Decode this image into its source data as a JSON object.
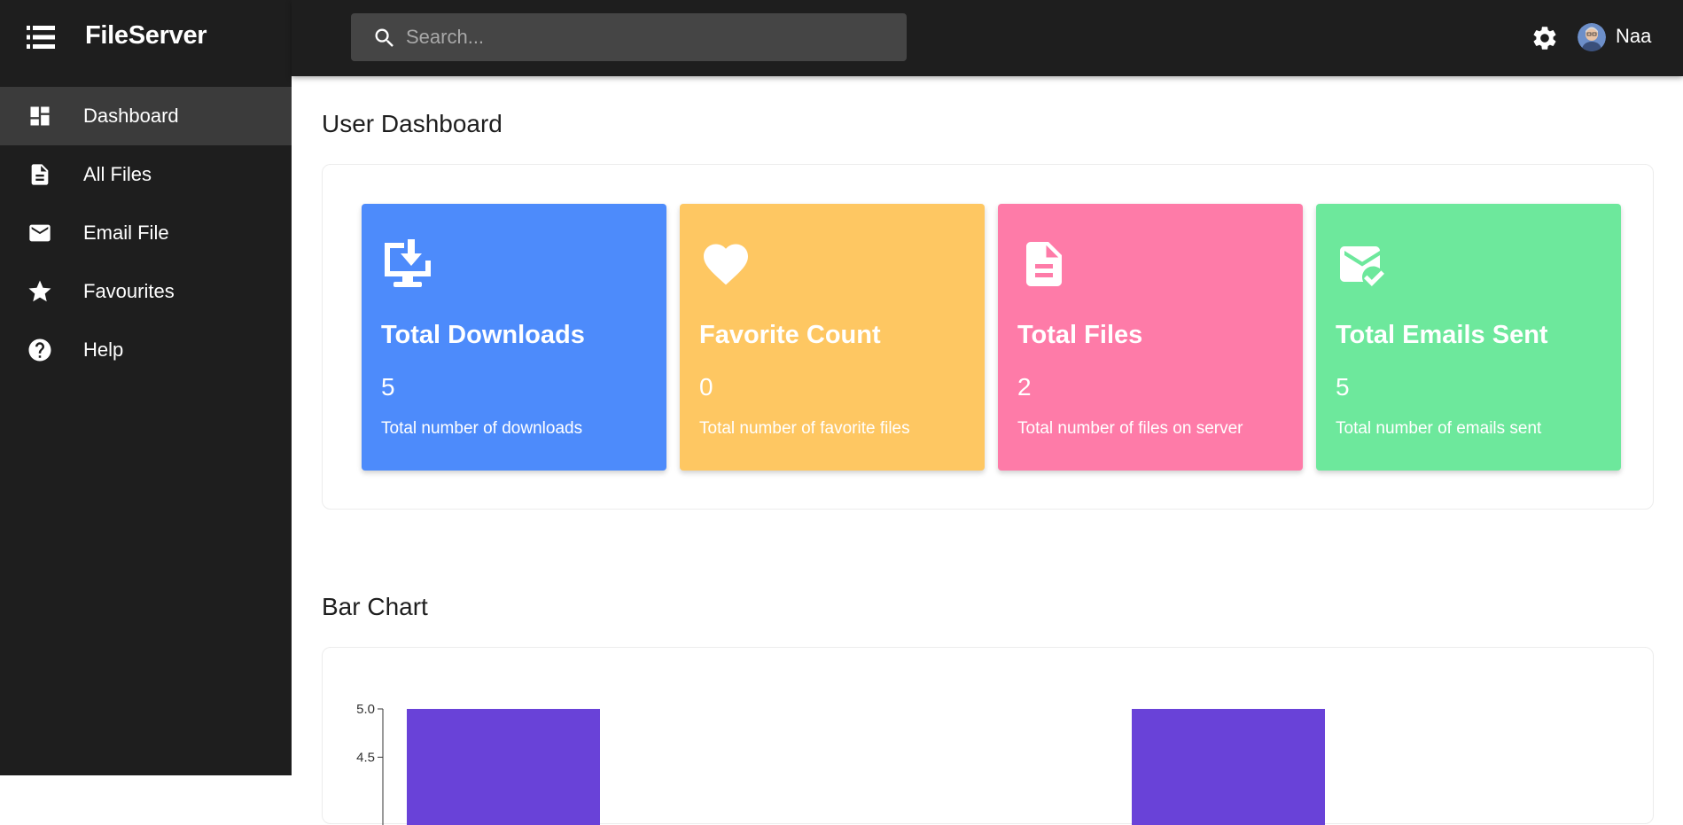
{
  "app": {
    "title": "FileServer"
  },
  "sidebar": {
    "items": [
      {
        "label": "Dashboard",
        "icon": "dashboard-icon",
        "active": true
      },
      {
        "label": "All Files",
        "icon": "file-icon"
      },
      {
        "label": "Email File",
        "icon": "mail-icon"
      },
      {
        "label": "Favourites",
        "icon": "star-icon"
      },
      {
        "label": "Help",
        "icon": "help-icon"
      }
    ]
  },
  "topbar": {
    "search_placeholder": "Search...",
    "user_name": "Naa"
  },
  "dashboard": {
    "title": "User Dashboard",
    "cards": [
      {
        "title": "Total Downloads",
        "value": "5",
        "description": "Total number of downloads",
        "color": "#4d8bfb",
        "icon": "download-icon"
      },
      {
        "title": "Favorite Count",
        "value": "0",
        "description": "Total number of favorite files",
        "color": "#fec762",
        "icon": "heart-icon"
      },
      {
        "title": "Total Files",
        "value": "2",
        "description": "Total number of files on server",
        "color": "#fe7ba8",
        "icon": "document-icon"
      },
      {
        "title": "Total Emails Sent",
        "value": "5",
        "description": "Total number of emails sent",
        "color": "#6de89c",
        "icon": "mail-check-icon"
      }
    ]
  },
  "chart_section": {
    "title": "Bar Chart"
  },
  "chart_data": {
    "type": "bar",
    "values": [
      5,
      5
    ],
    "color": "#6942d8",
    "ytick_labels": [
      "5.0",
      "4.5"
    ]
  }
}
